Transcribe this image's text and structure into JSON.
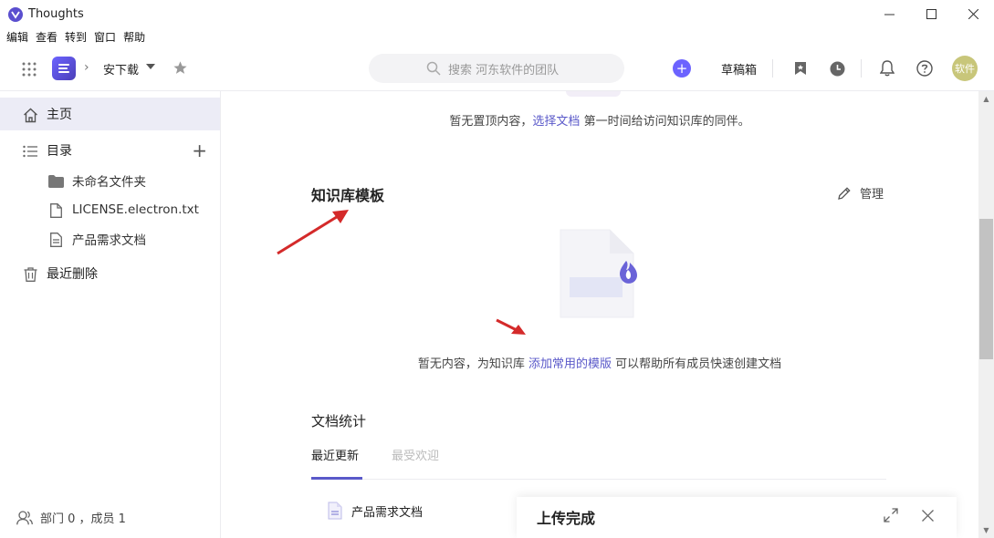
{
  "window": {
    "title": "Thoughts"
  },
  "menu": [
    "编辑",
    "查看",
    "转到",
    "窗口",
    "帮助"
  ],
  "topbar": {
    "space_name": "安下载",
    "search_placeholder": "搜索 河东软件的团队",
    "drafts_label": "草稿箱",
    "add_label": "+",
    "avatar_text": "软件",
    "accent_color": "#6c63ff"
  },
  "sidebar": {
    "items": [
      {
        "label": "主页",
        "icon": "home-icon"
      },
      {
        "label": "目录",
        "icon": "list-icon"
      },
      {
        "label": "未命名文件夹",
        "icon": "folder-icon"
      },
      {
        "label": "LICENSE.electron.txt",
        "icon": "file-icon"
      },
      {
        "label": "产品需求文档",
        "icon": "document-icon"
      },
      {
        "label": "最近删除",
        "icon": "trash-icon"
      }
    ],
    "footer": "部门 0 ，成员 1"
  },
  "main": {
    "pinned_empty_prefix": "暂无置顶内容，",
    "pinned_empty_link": "选择文档",
    "pinned_empty_suffix": " 第一时间给访问知识库的同伴。",
    "templates_title": "知识库模板",
    "manage_label": "管理",
    "templates_empty_prefix": "暂无内容，为知识库 ",
    "templates_empty_link": "添加常用的模版",
    "templates_empty_suffix": " 可以帮助所有成员快速创建文档",
    "stats_title": "文档统计",
    "tabs": [
      {
        "label": "最近更新",
        "active": true
      },
      {
        "label": "最受欢迎",
        "active": false
      }
    ],
    "recent_docs": [
      {
        "label": "产品需求文档"
      }
    ]
  },
  "upload": {
    "title": "上传完成"
  }
}
